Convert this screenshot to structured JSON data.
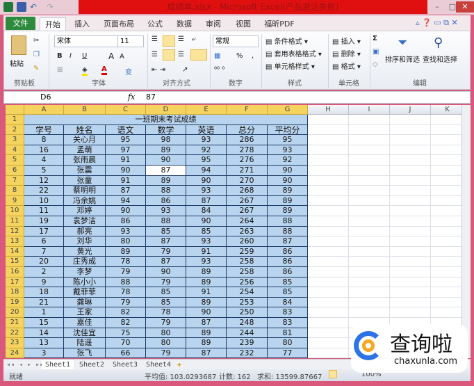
{
  "window": {
    "title": "成绩单.xlsx - Microsoft Excel(产品激活失败)"
  },
  "ribbon_tabs": [
    "文件",
    "开始",
    "插入",
    "页面布局",
    "公式",
    "数据",
    "审阅",
    "视图",
    "福昕PDF"
  ],
  "ribbon": {
    "clipboard": {
      "paste": "粘贴",
      "group": "剪贴板"
    },
    "font": {
      "name": "宋体",
      "size": "11",
      "bold": "B",
      "italic": "I",
      "underline": "U",
      "grow": "A",
      "shrink": "A",
      "group": "字体"
    },
    "alignment": {
      "group": "对齐方式"
    },
    "number": {
      "format": "常规",
      "percent": "%",
      "comma": ",",
      "group": "数字"
    },
    "styles": {
      "conditional": "条件格式",
      "table": "套用表格格式",
      "cell": "单元格样式",
      "group": "样式"
    },
    "cells": {
      "insert": "插入",
      "delete": "删除",
      "format": "格式",
      "group": "单元格"
    },
    "editing": {
      "sigma": "Σ",
      "sort": "排序和筛选",
      "find": "查找和选择",
      "group": "编辑"
    }
  },
  "formula_bar": {
    "name_box": "D6",
    "fx": "fx",
    "value": "87"
  },
  "columns": [
    "A",
    "B",
    "C",
    "D",
    "E",
    "F",
    "G",
    "H",
    "I",
    "J",
    "K"
  ],
  "sheet": {
    "title": "一班期末考试成绩",
    "headers": [
      "学号",
      "姓名",
      "语文",
      "数学",
      "英语",
      "总分",
      "平均分"
    ],
    "rows": [
      [
        "8",
        "关心月",
        "95",
        "98",
        "93",
        "286",
        "95"
      ],
      [
        "16",
        "孟萌",
        "97",
        "89",
        "92",
        "278",
        "93"
      ],
      [
        "4",
        "张雨晨",
        "91",
        "90",
        "95",
        "276",
        "92"
      ],
      [
        "5",
        "张震",
        "90",
        "87",
        "94",
        "271",
        "90"
      ],
      [
        "12",
        "张童",
        "91",
        "89",
        "90",
        "270",
        "90"
      ],
      [
        "22",
        "蔡明明",
        "87",
        "88",
        "93",
        "268",
        "89"
      ],
      [
        "10",
        "冯余姚",
        "94",
        "86",
        "87",
        "267",
        "89"
      ],
      [
        "11",
        "邓婷",
        "90",
        "93",
        "84",
        "267",
        "89"
      ],
      [
        "19",
        "袁梦洁",
        "86",
        "88",
        "90",
        "264",
        "88"
      ],
      [
        "17",
        "郝亮",
        "93",
        "85",
        "85",
        "263",
        "88"
      ],
      [
        "6",
        "刘华",
        "80",
        "87",
        "93",
        "260",
        "87"
      ],
      [
        "7",
        "黄光",
        "89",
        "79",
        "91",
        "259",
        "86"
      ],
      [
        "20",
        "庄秀成",
        "78",
        "87",
        "93",
        "258",
        "86"
      ],
      [
        "2",
        "李梦",
        "79",
        "90",
        "89",
        "258",
        "86"
      ],
      [
        "9",
        "陈小小",
        "88",
        "79",
        "89",
        "256",
        "85"
      ],
      [
        "18",
        "戴菲菲",
        "78",
        "85",
        "91",
        "254",
        "85"
      ],
      [
        "21",
        "龚琳",
        "79",
        "85",
        "89",
        "253",
        "84"
      ],
      [
        "1",
        "王家",
        "82",
        "78",
        "90",
        "250",
        "83"
      ],
      [
        "15",
        "嘉佳",
        "82",
        "79",
        "87",
        "248",
        "83"
      ],
      [
        "14",
        "沈佳宜",
        "75",
        "80",
        "89",
        "244",
        "81"
      ],
      [
        "13",
        "陆遥",
        "70",
        "80",
        "89",
        "239",
        "80"
      ],
      [
        "3",
        "张飞",
        "66",
        "79",
        "87",
        "232",
        "77"
      ]
    ]
  },
  "sheet_tabs": [
    "Sheet1",
    "Sheet2",
    "Sheet3",
    "Sheet4"
  ],
  "status": {
    "ready": "就绪",
    "average": "平均值: 103.0293687",
    "count": "计数: 162",
    "sum": "求和: 13599.87667",
    "zoom": "100%"
  },
  "watermark": {
    "text": "查询啦",
    "url": "chaxunla.com"
  },
  "colors": {
    "selection": "#b9d4ee",
    "header_active": "#f4d35e",
    "title_red": "#e01010",
    "file_tab": "#2e8b3e"
  }
}
